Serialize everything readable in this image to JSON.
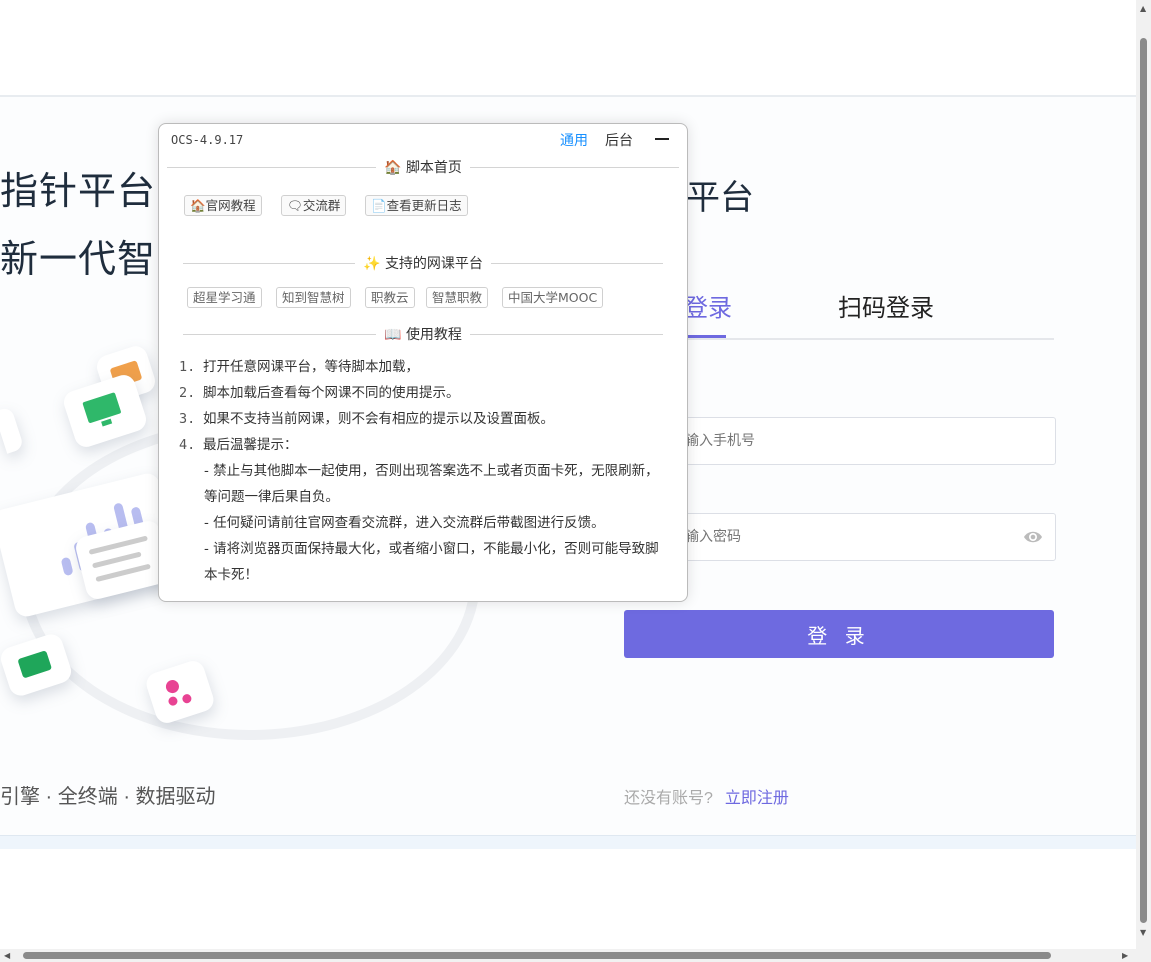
{
  "hero": {
    "line1": "指针平台",
    "line2": "新一代智",
    "slogan": "引擎 · 全终端 · 数据驱动"
  },
  "login": {
    "platform_title": "平台",
    "tab_password": "登录",
    "tab_qr": "扫码登录",
    "phone_placeholder": "输入手机号",
    "password_placeholder": "输入密码",
    "submit": "登 录",
    "register_question": "还没有账号?",
    "register_link": "立即注册",
    "accent_color": "#6e69e0"
  },
  "ocs_panel": {
    "version": "OCS-4.9.17",
    "tabs": [
      "通用",
      "后台"
    ],
    "active_tab": "通用",
    "home_section": {
      "title": "脚本首页",
      "links": [
        "官网教程",
        "交流群",
        "查看更新日志"
      ]
    },
    "platforms_section": {
      "title": "支持的网课平台",
      "items": [
        "超星学习通",
        "知到智慧树",
        "职教云",
        "智慧职教",
        "中国大学MOOC"
      ]
    },
    "guide_section": {
      "title": "使用教程",
      "steps": [
        "打开任意网课平台，等待脚本加载，",
        "脚本加载后查看每个网课不同的使用提示。",
        "如果不支持当前网课，则不会有相应的提示以及设置面板。",
        "最后温馨提示："
      ],
      "tips": [
        "- 禁止与其他脚本一起使用，否则出现答案选不上或者页面卡死，无限刷新，等问题一律后果自负。",
        "- 任何疑问请前往官网查看交流群，进入交流群后带截图进行反馈。",
        "- 请将浏览器页面保持最大化，或者缩小窗口，不能最小化，否则可能导致脚本卡死！"
      ]
    }
  }
}
